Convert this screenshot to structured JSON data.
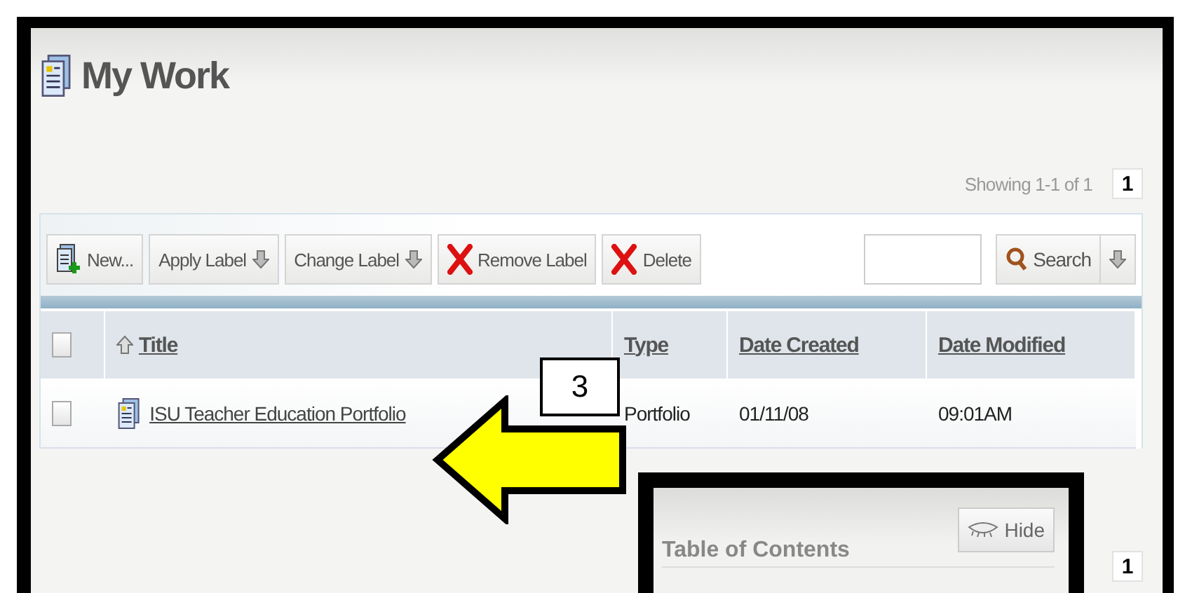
{
  "page": {
    "title": "My Work"
  },
  "pagination_top": {
    "showing": "Showing 1-1 of 1",
    "pages": [
      {
        "label": "1",
        "selected": true
      }
    ]
  },
  "toolbar": {
    "buttons": [
      {
        "label": "New...",
        "kind": "new"
      },
      {
        "label": "Apply Label",
        "kind": "dropdown"
      },
      {
        "label": "Change Label",
        "kind": "dropdown"
      },
      {
        "label": "Remove Label",
        "kind": "remove"
      },
      {
        "label": "Delete",
        "kind": "remove"
      }
    ],
    "search": {
      "button": "Search"
    }
  },
  "table": {
    "select_all_checked": false,
    "columns": [
      {
        "label": "Title",
        "sorted": true
      },
      {
        "label": "Type",
        "sorted": false
      },
      {
        "label": "Date Created",
        "sorted": false
      },
      {
        "label": "Date Modified",
        "sorted": false
      }
    ],
    "rows": [
      {
        "checked": false,
        "title": "ISU Teacher Education Portfolio",
        "type": "Portfolio",
        "date_created": "01/11/08",
        "date_modified": "09:01AM"
      }
    ]
  },
  "pagination_bottom": {
    "pages": [
      {
        "label": "1",
        "selected": true
      }
    ]
  },
  "callout": {
    "label": "3"
  },
  "inset_panel": {
    "title": "Table of Contents",
    "hide_button": "Hide"
  }
}
